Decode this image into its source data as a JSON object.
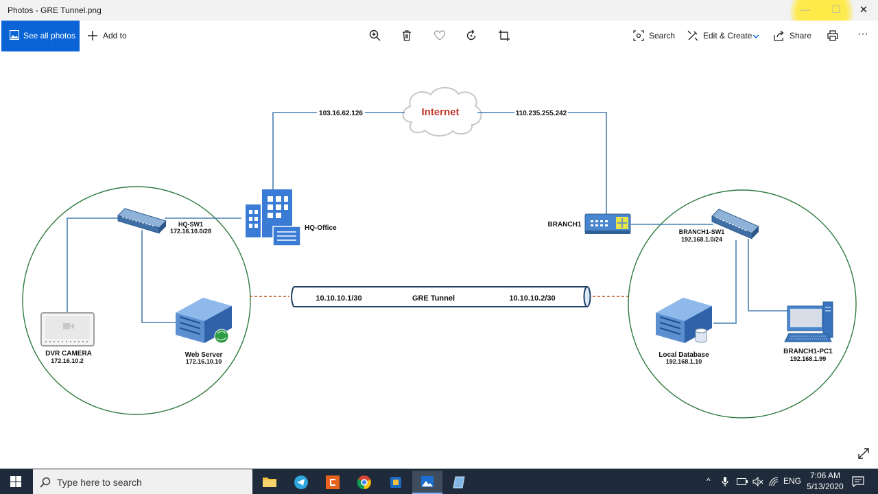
{
  "window": {
    "title": "Photos - GRE Tunnel.png",
    "minimize": "—",
    "maximize": "☐",
    "close": "✕"
  },
  "toolbar": {
    "see_all": "See all photos",
    "add_to": "Add to",
    "search": "Search",
    "edit_create": "Edit & Create",
    "share": "Share",
    "more": "···",
    "icons": [
      "zoom-in-icon",
      "delete-icon",
      "heart-icon",
      "rotate-icon",
      "crop-icon",
      "print-icon"
    ]
  },
  "diagram": {
    "internet": "Internet",
    "hq_ip": "103.16.62.126",
    "branch_ip": "110.235.255.242",
    "hq_office": "HQ-Office",
    "hq_sw": {
      "name": "HQ-SW1",
      "net": "172.16.10.0/28"
    },
    "branch1": "BRANCH1",
    "branch_sw": {
      "name": "BRANCH1-SW1",
      "net": "192.168.1.0/24"
    },
    "tunnel": {
      "left": "10.10.10.1/30",
      "label": "GRE Tunnel",
      "right": "10.10.10.2/30"
    },
    "dvr": {
      "name": "DVR CAMERA",
      "ip": "172.16.10.2"
    },
    "webserver": {
      "name": "Web Server",
      "ip": "172.16.10.10"
    },
    "localdb": {
      "name": "Local Database",
      "ip": "192.168.1.10"
    },
    "pc": {
      "name": "BRANCH1-PC1",
      "ip": "192.168.1.99"
    }
  },
  "taskbar": {
    "search_placeholder": "Type here to search",
    "language": "ENG",
    "time": "7:06 AM",
    "date": "5/13/2020",
    "accent": "#0a64d6"
  }
}
